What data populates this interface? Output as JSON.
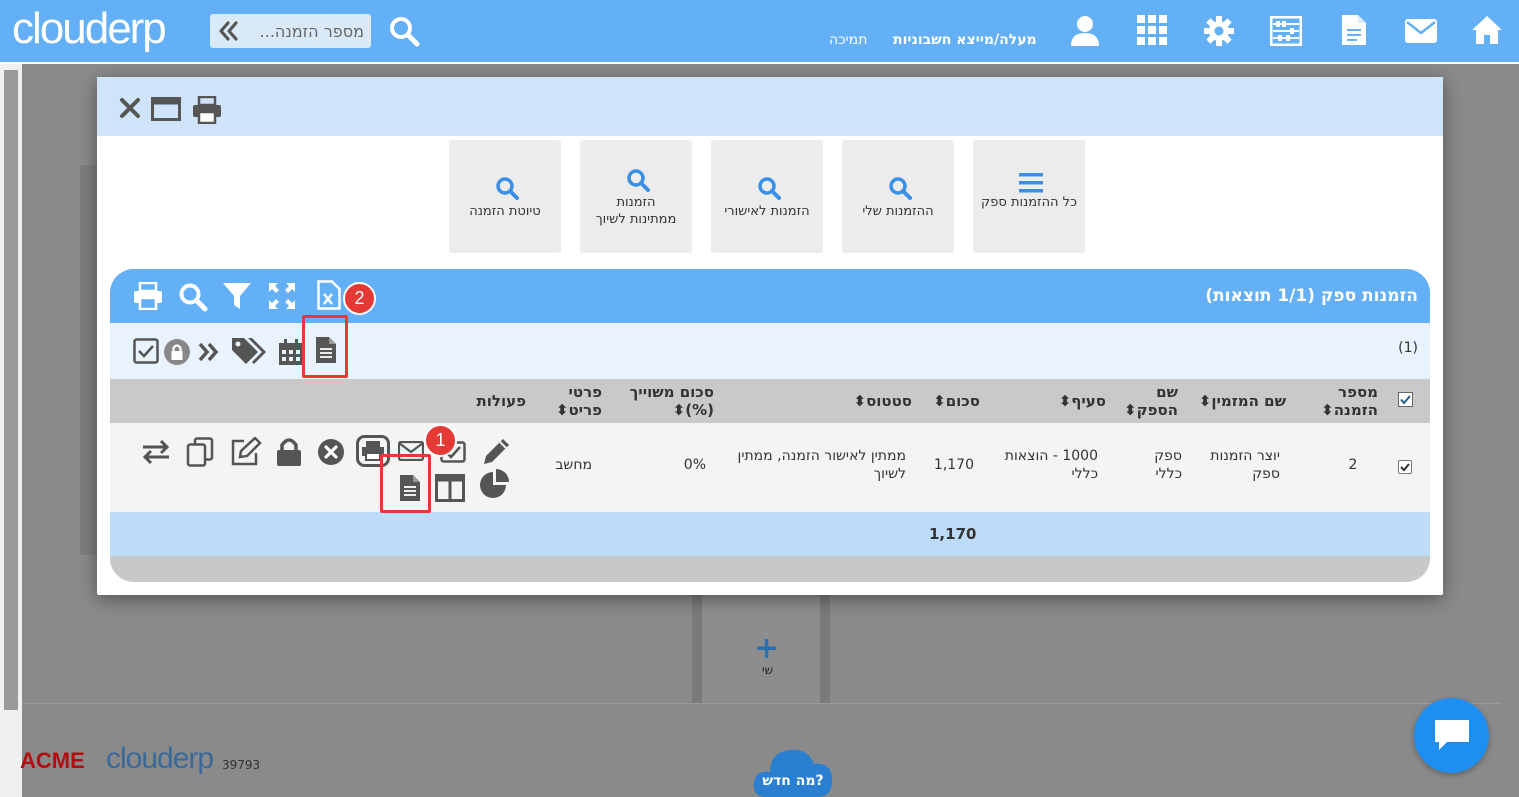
{
  "topbar": {
    "logo": "clouderp",
    "search_placeholder": "מספר הזמנה...",
    "link_support": "תמיכה",
    "link_accounts": "מעלה/מייצא חשבוניות"
  },
  "background": {
    "tile_label": "שי",
    "footer_acme": "ACME",
    "footer_logo": "clouderp",
    "footer_number": "39793",
    "cloud_label": "מה חדש?"
  },
  "nav_tiles": [
    {
      "label": "כל ההזמנות ספק",
      "icon": "list-icon"
    },
    {
      "label": "ההזמנות שלי",
      "icon": "search-icon"
    },
    {
      "label": "הזמנות לאישורי",
      "icon": "search-icon"
    },
    {
      "label": "הזמנות ממתינות לשיוך",
      "icon": "search-icon"
    },
    {
      "label": "טיוטת הזמנה",
      "icon": "search-icon"
    }
  ],
  "grid": {
    "title": "הזמנות ספק (1/1 תוצאות)",
    "count": "(1)",
    "badge_1": "1",
    "badge_2": "2",
    "columns": {
      "order_number": "מספר הזמנה",
      "creator_name": "שם המזמין",
      "supplier_name": "שם הספק",
      "section": "סעיף",
      "amount": "סכום",
      "status": "סטטוס",
      "assigned_amount": "סכום משוייך (%)",
      "item_details": "פרטי פריט",
      "actions": "פעולות"
    },
    "rows": [
      {
        "order_number": "2",
        "creator_name": "יוצר הזמנות ספק",
        "supplier_name": "ספק כללי",
        "section": "1000 - הוצאות כללי",
        "amount": "1,170",
        "status": "ממתין לאישור הזמנה, ממתין לשיוך",
        "assigned_amount": "0%",
        "item_details": "מחשב"
      }
    ],
    "total_amount": "1,170"
  },
  "colors": {
    "primary": "#63b0f6",
    "light": "#cfe4fb",
    "highlight": "#e53935",
    "icon_gray": "#555555"
  }
}
